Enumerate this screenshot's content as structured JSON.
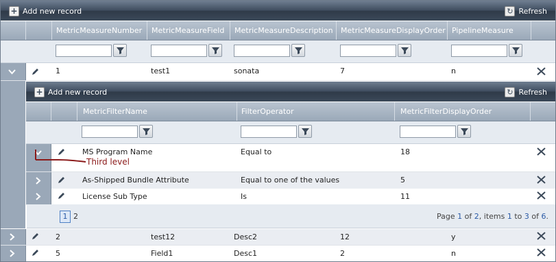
{
  "top_toolbar": {
    "add_label": "Add new record",
    "refresh_label": "Refresh"
  },
  "top_columns": [
    "MetricMeasureNumber",
    "MetricMeasureField",
    "MetricMeasureDescription",
    "MetricMeasureDisplayOrder",
    "PipelineMeasure"
  ],
  "top_rows": [
    {
      "number": "1",
      "field": "test1",
      "description": "sonata",
      "display_order": "7",
      "pipeline": "n"
    },
    {
      "number": "2",
      "field": "test12",
      "description": "Desc2",
      "display_order": "12",
      "pipeline": "y"
    },
    {
      "number": "5",
      "field": "Field1",
      "description": "Desc1",
      "display_order": "2",
      "pipeline": "n"
    }
  ],
  "nested_toolbar": {
    "add_label": "Add new record",
    "refresh_label": "Refresh"
  },
  "nested_columns": [
    "MetricFilterName",
    "FilterOperator",
    "MetricFilterDisplayOrder"
  ],
  "nested_rows": [
    {
      "name": "MS Program Name",
      "operator": "Equal to",
      "display_order": "18"
    },
    {
      "name": "As-Shipped Bundle Attribute",
      "operator": "Equal to one of the values",
      "display_order": "5"
    },
    {
      "name": "License Sub Type",
      "operator": "Is",
      "display_order": "11"
    }
  ],
  "annotation": "Third level",
  "pager": {
    "pages": [
      "1",
      "2"
    ],
    "info_prefix": "Page ",
    "page": "1",
    "of_text": " of ",
    "total_pages": "2",
    "items_text": ", items ",
    "from": "1",
    "to_text": " to ",
    "to": "3",
    "of2": " of ",
    "total": "6",
    "end": "."
  },
  "colors": {
    "annotation": "#8b1a1a",
    "header_dark": "#3b4959",
    "link_blue": "#2a5aa6"
  },
  "icons": {
    "edit": "pencil-icon",
    "delete": "x-icon",
    "expand": "chevron-right-icon",
    "collapse": "chevron-down-icon",
    "filter": "funnel-icon"
  }
}
